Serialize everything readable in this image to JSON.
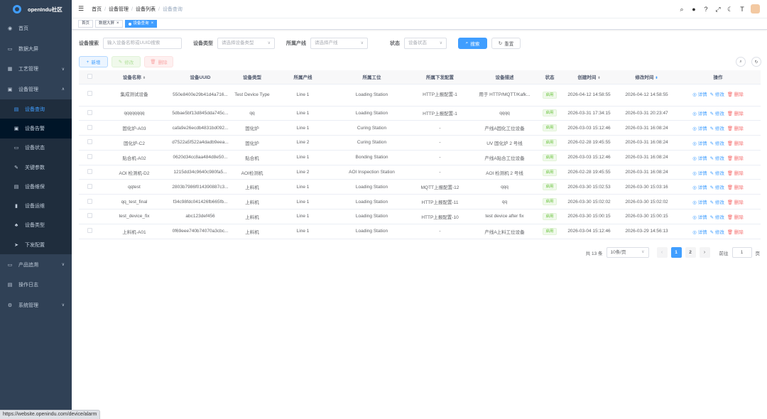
{
  "sidebar": {
    "brand": "openIndu社区",
    "menu_top": [
      {
        "label": "首页",
        "icon": "dashboard-icon"
      },
      {
        "label": "数据大屏",
        "icon": "monitor-icon"
      },
      {
        "label": "工艺管理",
        "icon": "grid-icon",
        "arrow": "∨"
      },
      {
        "label": "设备管理",
        "icon": "device-icon",
        "arrow": "∧"
      }
    ],
    "submenu": [
      {
        "label": "设备查询",
        "icon": "list-icon"
      },
      {
        "label": "设备告警",
        "icon": "alarm-icon"
      },
      {
        "label": "设备状态",
        "icon": "status-icon"
      },
      {
        "label": "关键参数",
        "icon": "edit-icon"
      },
      {
        "label": "设备维保",
        "icon": "maintain-icon"
      },
      {
        "label": "设备运维",
        "icon": "ops-icon"
      },
      {
        "label": "设备类型",
        "icon": "tree-icon"
      },
      {
        "label": "下发配置",
        "icon": "send-icon"
      }
    ],
    "menu_bottom": [
      {
        "label": "产品追溯",
        "icon": "trace-icon",
        "arrow": "∨"
      },
      {
        "label": "操作日志",
        "icon": "log-icon"
      },
      {
        "label": "系统管理",
        "icon": "gear-icon",
        "arrow": "∨"
      }
    ]
  },
  "navbar": {
    "breadcrumb": [
      "首页",
      "设备管理",
      "设备列表",
      "设备查询"
    ]
  },
  "tags": [
    {
      "label": "首页"
    },
    {
      "label": "数据大屏"
    },
    {
      "label": "设备查询"
    }
  ],
  "filters": {
    "search_label": "设备搜索",
    "search_placeholder": "输入设备名称或UUID搜索",
    "type_label": "设备类型",
    "type_placeholder": "请选择设备类型",
    "line_label": "所属产线",
    "line_placeholder": "请选择产线",
    "status_label": "状态",
    "status_placeholder": "设备状态",
    "search_button": "搜索",
    "reset_button": "重置"
  },
  "toolbar": {
    "add": "新增",
    "edit": "修改",
    "delete": "删除"
  },
  "table": {
    "headers": [
      "设备名称",
      "设备UUID",
      "设备类型",
      "所属产线",
      "所属工位",
      "所属下发配置",
      "设备描述",
      "状态",
      "创建时间",
      "修改时间",
      "操作"
    ],
    "ops": {
      "detail": "详情",
      "edit": "修改",
      "delete": "删除"
    },
    "rows": [
      {
        "name": "集成测试设备",
        "uuid": "550e8400e29b41d4a716...",
        "type": "Test Device Type",
        "line": "Line 1",
        "station": "Loading Station",
        "config": "HTTP上报配置-1",
        "desc": "用于 HTTP/MQTT/Kafk...",
        "status": "启用",
        "created": "2026-04-12 14:58:55",
        "modified": "2026-04-12 14:58:55"
      },
      {
        "name": "qqqqqqqq",
        "uuid": "5dbae5bf13d845dda745c...",
        "type": "qq",
        "line": "Line 1",
        "station": "Loading Station",
        "config": "HTTP上报配置-1",
        "desc": "qqqq",
        "status": "启用",
        "created": "2026-03-31 17:34:15",
        "modified": "2026-03-31 20:23:47"
      },
      {
        "name": "固化炉-A03",
        "uuid": "cafa9e26ecdb4831bd092...",
        "type": "固化炉",
        "line": "Line 1",
        "station": "Curing Station",
        "config": "-",
        "desc": "产线A固化工位设备",
        "status": "启用",
        "created": "2026-03-03 15:12:46",
        "modified": "2026-03-31 16:08:24"
      },
      {
        "name": "固化炉-C2",
        "uuid": "d7522a5f522a4dadb9eea...",
        "type": "固化炉",
        "line": "Line 2",
        "station": "Curing Station",
        "config": "-",
        "desc": "UV 固化炉 2 号线",
        "status": "启用",
        "created": "2026-02-28 19:45:55",
        "modified": "2026-03-31 16:08:24"
      },
      {
        "name": "贴合机-A02",
        "uuid": "0620d34cc8aa484d8e50...",
        "type": "贴合机",
        "line": "Line 1",
        "station": "Bonding Station",
        "config": "-",
        "desc": "产线A贴合工位设备",
        "status": "启用",
        "created": "2026-03-03 15:12:46",
        "modified": "2026-03-31 16:08:24"
      },
      {
        "name": "AOI 检测机-D2",
        "uuid": "1215dd34c9640c980fa5...",
        "type": "AOI检测机",
        "line": "Line 2",
        "station": "AOI Inspection Station",
        "config": "-",
        "desc": "AOI 检测机 2 号线",
        "status": "启用",
        "created": "2026-02-28 19:45:55",
        "modified": "2026-03-31 16:08:24"
      },
      {
        "name": "qqtest",
        "uuid": "2803b7986f014390887c3...",
        "type": "上料机",
        "line": "Line 1",
        "station": "Loading Station",
        "config": "MQTT上报配置-12",
        "desc": "qqq",
        "status": "启用",
        "created": "2026-03-30 15:02:53",
        "modified": "2026-03-30 15:03:16"
      },
      {
        "name": "qq_test_final",
        "uuid": "f34c98fdc041426fb665fb...",
        "type": "上料机",
        "line": "Line 1",
        "station": "Loading Station",
        "config": "HTTP上报配置-11",
        "desc": "qq",
        "status": "启用",
        "created": "2026-03-30 15:02:02",
        "modified": "2026-03-30 15:02:02"
      },
      {
        "name": "test_device_fix",
        "uuid": "abc123def456",
        "type": "上料机",
        "line": "Line 1",
        "station": "Loading Station",
        "config": "HTTP上报配置-10",
        "desc": "test device after fix",
        "status": "启用",
        "created": "2026-03-30 15:00:15",
        "modified": "2026-03-30 15:00:15"
      },
      {
        "name": "上料机-A01",
        "uuid": "0f69eee740b74070a3cbc...",
        "type": "上料机",
        "line": "Line 1",
        "station": "Loading Station",
        "config": "-",
        "desc": "产线A上料工位设备",
        "status": "启用",
        "created": "2026-03-04 15:12:46",
        "modified": "2026-03-29 14:56:13"
      }
    ]
  },
  "pagination": {
    "total": "共 13 条",
    "page_size": "10条/页",
    "pages": [
      "1",
      "2"
    ],
    "goto_label": "前往",
    "goto_value": "1",
    "page_suffix": "页"
  },
  "statusbar": {
    "url": "https://website.openindu.com/device/alarm"
  }
}
